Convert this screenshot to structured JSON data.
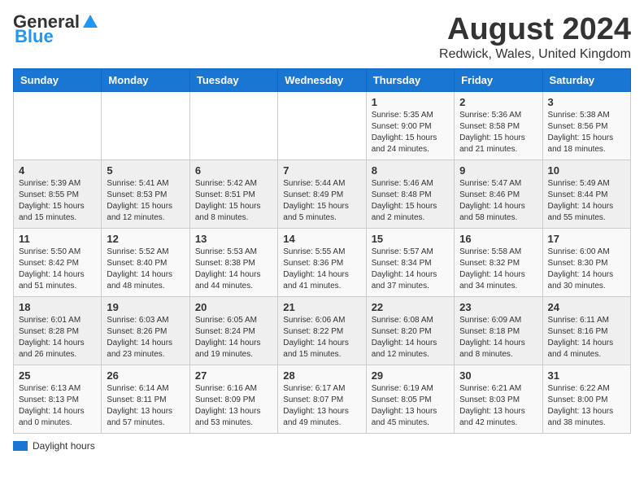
{
  "header": {
    "logo_general": "General",
    "logo_blue": "Blue",
    "month_title": "August 2024",
    "location": "Redwick, Wales, United Kingdom"
  },
  "days_of_week": [
    "Sunday",
    "Monday",
    "Tuesday",
    "Wednesday",
    "Thursday",
    "Friday",
    "Saturday"
  ],
  "weeks": [
    [
      {
        "day": "",
        "info": ""
      },
      {
        "day": "",
        "info": ""
      },
      {
        "day": "",
        "info": ""
      },
      {
        "day": "",
        "info": ""
      },
      {
        "day": "1",
        "info": "Sunrise: 5:35 AM\nSunset: 9:00 PM\nDaylight: 15 hours\nand 24 minutes."
      },
      {
        "day": "2",
        "info": "Sunrise: 5:36 AM\nSunset: 8:58 PM\nDaylight: 15 hours\nand 21 minutes."
      },
      {
        "day": "3",
        "info": "Sunrise: 5:38 AM\nSunset: 8:56 PM\nDaylight: 15 hours\nand 18 minutes."
      }
    ],
    [
      {
        "day": "4",
        "info": "Sunrise: 5:39 AM\nSunset: 8:55 PM\nDaylight: 15 hours\nand 15 minutes."
      },
      {
        "day": "5",
        "info": "Sunrise: 5:41 AM\nSunset: 8:53 PM\nDaylight: 15 hours\nand 12 minutes."
      },
      {
        "day": "6",
        "info": "Sunrise: 5:42 AM\nSunset: 8:51 PM\nDaylight: 15 hours\nand 8 minutes."
      },
      {
        "day": "7",
        "info": "Sunrise: 5:44 AM\nSunset: 8:49 PM\nDaylight: 15 hours\nand 5 minutes."
      },
      {
        "day": "8",
        "info": "Sunrise: 5:46 AM\nSunset: 8:48 PM\nDaylight: 15 hours\nand 2 minutes."
      },
      {
        "day": "9",
        "info": "Sunrise: 5:47 AM\nSunset: 8:46 PM\nDaylight: 14 hours\nand 58 minutes."
      },
      {
        "day": "10",
        "info": "Sunrise: 5:49 AM\nSunset: 8:44 PM\nDaylight: 14 hours\nand 55 minutes."
      }
    ],
    [
      {
        "day": "11",
        "info": "Sunrise: 5:50 AM\nSunset: 8:42 PM\nDaylight: 14 hours\nand 51 minutes."
      },
      {
        "day": "12",
        "info": "Sunrise: 5:52 AM\nSunset: 8:40 PM\nDaylight: 14 hours\nand 48 minutes."
      },
      {
        "day": "13",
        "info": "Sunrise: 5:53 AM\nSunset: 8:38 PM\nDaylight: 14 hours\nand 44 minutes."
      },
      {
        "day": "14",
        "info": "Sunrise: 5:55 AM\nSunset: 8:36 PM\nDaylight: 14 hours\nand 41 minutes."
      },
      {
        "day": "15",
        "info": "Sunrise: 5:57 AM\nSunset: 8:34 PM\nDaylight: 14 hours\nand 37 minutes."
      },
      {
        "day": "16",
        "info": "Sunrise: 5:58 AM\nSunset: 8:32 PM\nDaylight: 14 hours\nand 34 minutes."
      },
      {
        "day": "17",
        "info": "Sunrise: 6:00 AM\nSunset: 8:30 PM\nDaylight: 14 hours\nand 30 minutes."
      }
    ],
    [
      {
        "day": "18",
        "info": "Sunrise: 6:01 AM\nSunset: 8:28 PM\nDaylight: 14 hours\nand 26 minutes."
      },
      {
        "day": "19",
        "info": "Sunrise: 6:03 AM\nSunset: 8:26 PM\nDaylight: 14 hours\nand 23 minutes."
      },
      {
        "day": "20",
        "info": "Sunrise: 6:05 AM\nSunset: 8:24 PM\nDaylight: 14 hours\nand 19 minutes."
      },
      {
        "day": "21",
        "info": "Sunrise: 6:06 AM\nSunset: 8:22 PM\nDaylight: 14 hours\nand 15 minutes."
      },
      {
        "day": "22",
        "info": "Sunrise: 6:08 AM\nSunset: 8:20 PM\nDaylight: 14 hours\nand 12 minutes."
      },
      {
        "day": "23",
        "info": "Sunrise: 6:09 AM\nSunset: 8:18 PM\nDaylight: 14 hours\nand 8 minutes."
      },
      {
        "day": "24",
        "info": "Sunrise: 6:11 AM\nSunset: 8:16 PM\nDaylight: 14 hours\nand 4 minutes."
      }
    ],
    [
      {
        "day": "25",
        "info": "Sunrise: 6:13 AM\nSunset: 8:13 PM\nDaylight: 14 hours\nand 0 minutes."
      },
      {
        "day": "26",
        "info": "Sunrise: 6:14 AM\nSunset: 8:11 PM\nDaylight: 13 hours\nand 57 minutes."
      },
      {
        "day": "27",
        "info": "Sunrise: 6:16 AM\nSunset: 8:09 PM\nDaylight: 13 hours\nand 53 minutes."
      },
      {
        "day": "28",
        "info": "Sunrise: 6:17 AM\nSunset: 8:07 PM\nDaylight: 13 hours\nand 49 minutes."
      },
      {
        "day": "29",
        "info": "Sunrise: 6:19 AM\nSunset: 8:05 PM\nDaylight: 13 hours\nand 45 minutes."
      },
      {
        "day": "30",
        "info": "Sunrise: 6:21 AM\nSunset: 8:03 PM\nDaylight: 13 hours\nand 42 minutes."
      },
      {
        "day": "31",
        "info": "Sunrise: 6:22 AM\nSunset: 8:00 PM\nDaylight: 13 hours\nand 38 minutes."
      }
    ]
  ],
  "legend": {
    "color_label": "Daylight hours"
  }
}
